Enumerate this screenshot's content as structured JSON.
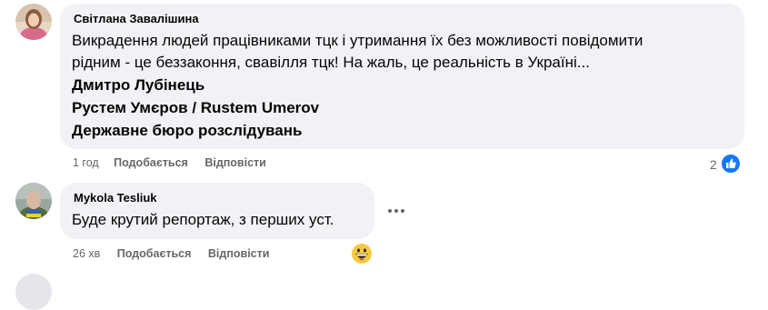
{
  "comments": [
    {
      "author": "Світлана Завалішина",
      "text_line1": "Викрадення людей працівниками тцк і утримання їх без можливості повідомити",
      "text_line2": "рідним - це беззаконня, свавілля тцк! На жаль, це реальність в Україні...",
      "mentions": [
        "Дмитро Лубінець",
        "Рустем Умєров / Rustem Umerov",
        "Державне бюро розслідувань"
      ],
      "time": "1 год",
      "like_label": "Подобається",
      "reply_label": "Відповісти",
      "reaction_count": "2",
      "reaction_icon": "like-icon"
    },
    {
      "author": "Mykola Tesliuk",
      "text": "Буде крутий репортаж, з перших уст.",
      "time": "26 хв",
      "like_label": "Подобається",
      "reply_label": "Відповісти",
      "reaction_icon": "grinning-face-emoji",
      "more_icon": "more-options-icon"
    }
  ],
  "colors": {
    "bubble": "#f0f2f5",
    "meta_text": "#65676b",
    "like_blue": "#1877f2"
  }
}
